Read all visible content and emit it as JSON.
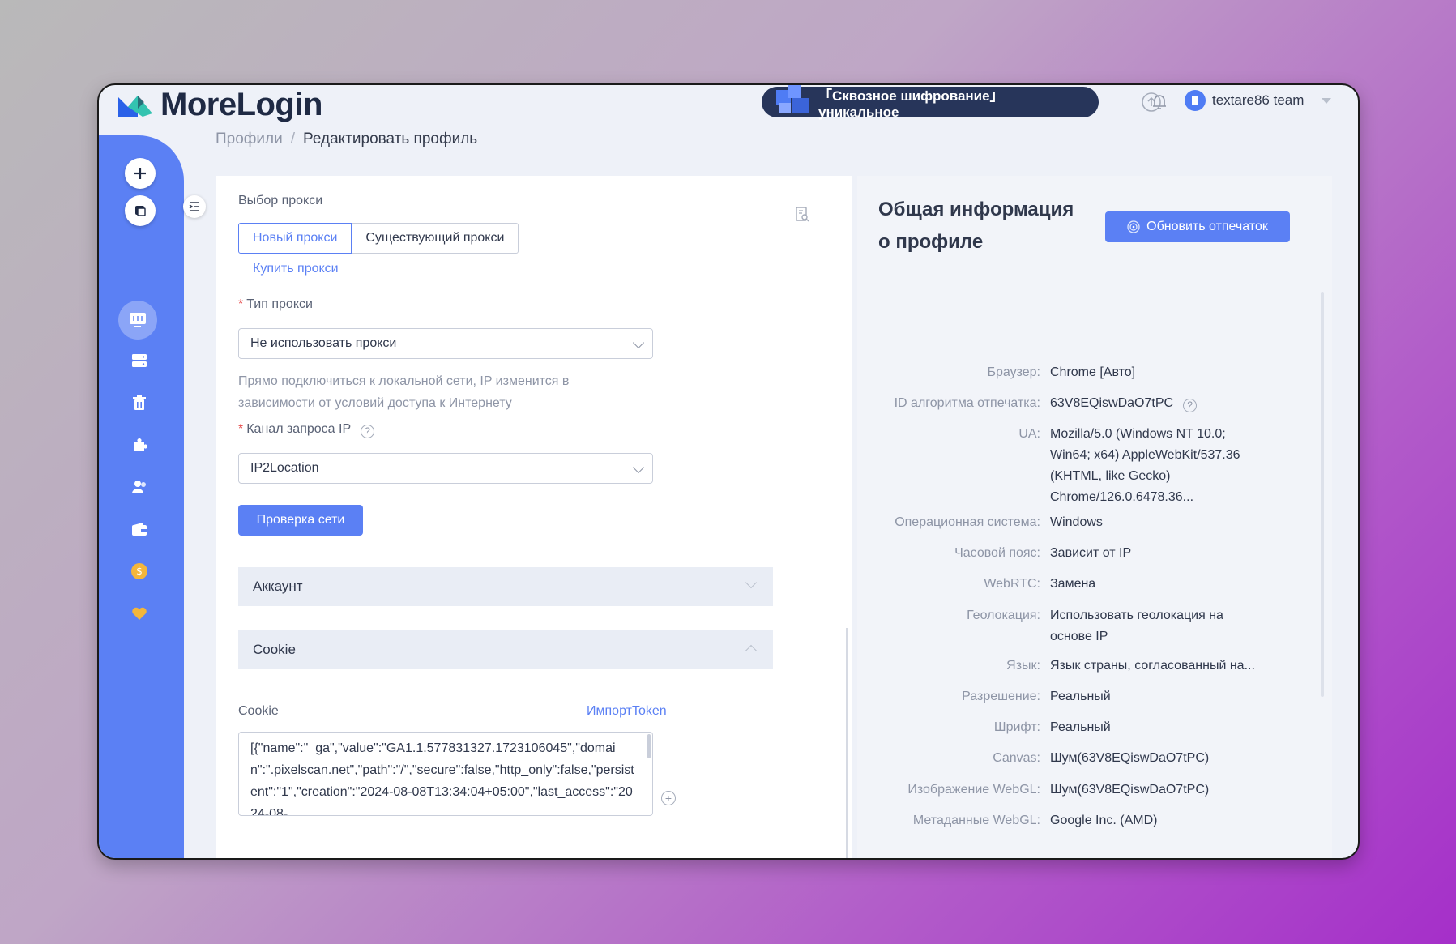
{
  "app": {
    "name": "MoreLogin"
  },
  "header": {
    "promo_part1": "「Сквозное шифрование」",
    "promo_part2": "уникальное",
    "team_name": "textare86 team"
  },
  "breadcrumb": {
    "root": "Профили",
    "separator": "/",
    "current": "Редактировать профиль"
  },
  "proxy": {
    "section_label": "Выбор прокси",
    "tab_new": "Новый прокси",
    "tab_existing": "Существующий прокси",
    "buy_link": "Купить прокси",
    "type_label": "Тип прокси",
    "type_value": "Не использовать прокси",
    "type_hint": "Прямо подключиться к локальной сети, IP изменится в зависимости от условий доступа к Интернету",
    "channel_label": "Канал запроса IP",
    "channel_value": "IP2Location",
    "check_button": "Проверка сети"
  },
  "accordions": {
    "account": "Аккаунт",
    "cookie": "Cookie"
  },
  "cookie": {
    "label": "Cookie",
    "import_link": "ИмпортToken",
    "value": "[{\"name\":\"_ga\",\"value\":\"GA1.1.577831327.1723106045\",\"domain\":\".pixelscan.net\",\"path\":\"/\",\"secure\":false,\"http_only\":false,\"persistent\":\"1\",\"creation\":\"2024-08-08T13:34:04+05:00\",\"last_access\":\"2024-08-"
  },
  "info": {
    "title": "Общая информация о профиле",
    "refresh_button": "Обновить отпечаток",
    "rows": [
      {
        "k": "Браузер:",
        "v": "Chrome [Авто]"
      },
      {
        "k": "ID алгоритма отпечатка:",
        "v": "63V8EQiswDaO7tPC"
      },
      {
        "k": "UA:",
        "v": "Mozilla/5.0 (Windows NT 10.0; Win64; x64) AppleWebKit/537.36 (KHTML, like Gecko) Chrome/126.0.6478.36..."
      },
      {
        "k": "Операционная система:",
        "v": "Windows"
      },
      {
        "k": "Часовой пояс:",
        "v": "Зависит от IP"
      },
      {
        "k": "WebRTC:",
        "v": "Замена"
      },
      {
        "k": "Геолокация:",
        "v": "Использовать геолокация на основе IP"
      },
      {
        "k": "Язык:",
        "v": "Язык страны, согласованный на..."
      },
      {
        "k": "Разрешение:",
        "v": "Реальный"
      },
      {
        "k": "Шрифт:",
        "v": "Реальный"
      },
      {
        "k": "Canvas:",
        "v": "Шум(63V8EQiswDaO7tPC)"
      },
      {
        "k": "Изображение WebGL:",
        "v": "Шум(63V8EQiswDaO7tPC)"
      },
      {
        "k": "Метаданные WebGL:",
        "v": "Google Inc. (AMD)"
      }
    ]
  },
  "colors": {
    "accent": "#5b80f4",
    "sidebar": "#5b80f4",
    "promo_bg": "#27355a"
  }
}
